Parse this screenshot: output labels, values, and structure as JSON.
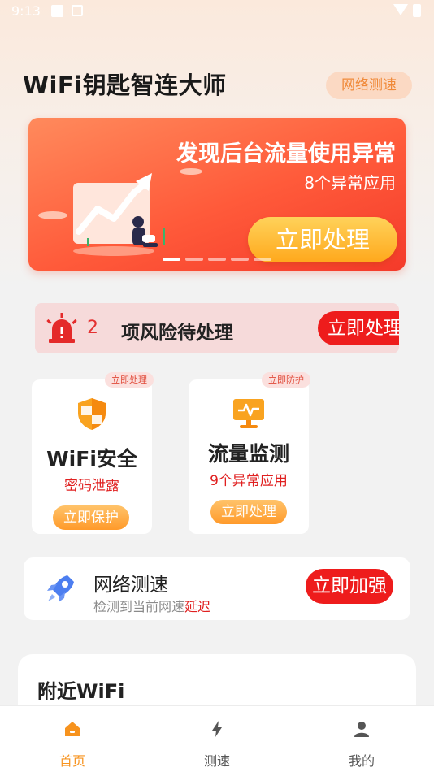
{
  "status_bar": {
    "time": "9:13"
  },
  "header": {
    "title": "WiFi钥匙智连大师",
    "speed_chip": "网络测速"
  },
  "banner": {
    "title": "发现后台流量使用异常",
    "subtitle": "8个异常应用",
    "button": "立即处理",
    "slide_count": 5,
    "active_slide": 1
  },
  "risk_bar": {
    "count": "2",
    "text": "项风险待处理",
    "button": "立即处理"
  },
  "cards": [
    {
      "badge": "立即处理",
      "icon": "shield-icon",
      "title": "WiFi安全",
      "subtitle": "密码泄露",
      "button": "立即保护"
    },
    {
      "badge": "立即防护",
      "icon": "monitor-icon",
      "title": "流量监测",
      "subtitle": "9个异常应用",
      "button": "立即处理"
    }
  ],
  "speed_card": {
    "icon": "rocket-icon",
    "title": "网络测速",
    "desc": "检测到当前网速",
    "desc_highlight": "延迟",
    "button": "立即加强"
  },
  "nearby": {
    "title": "附近WiFi"
  },
  "bottom_nav": {
    "items": [
      {
        "label": "首页",
        "icon": "home-icon",
        "active": true
      },
      {
        "label": "测速",
        "icon": "lightning-icon",
        "active": false
      },
      {
        "label": "我的",
        "icon": "user-icon",
        "active": false
      }
    ]
  },
  "colors": {
    "accent": "#f7931e",
    "danger": "#ee1c1c",
    "banner": "#ff5a3a"
  }
}
